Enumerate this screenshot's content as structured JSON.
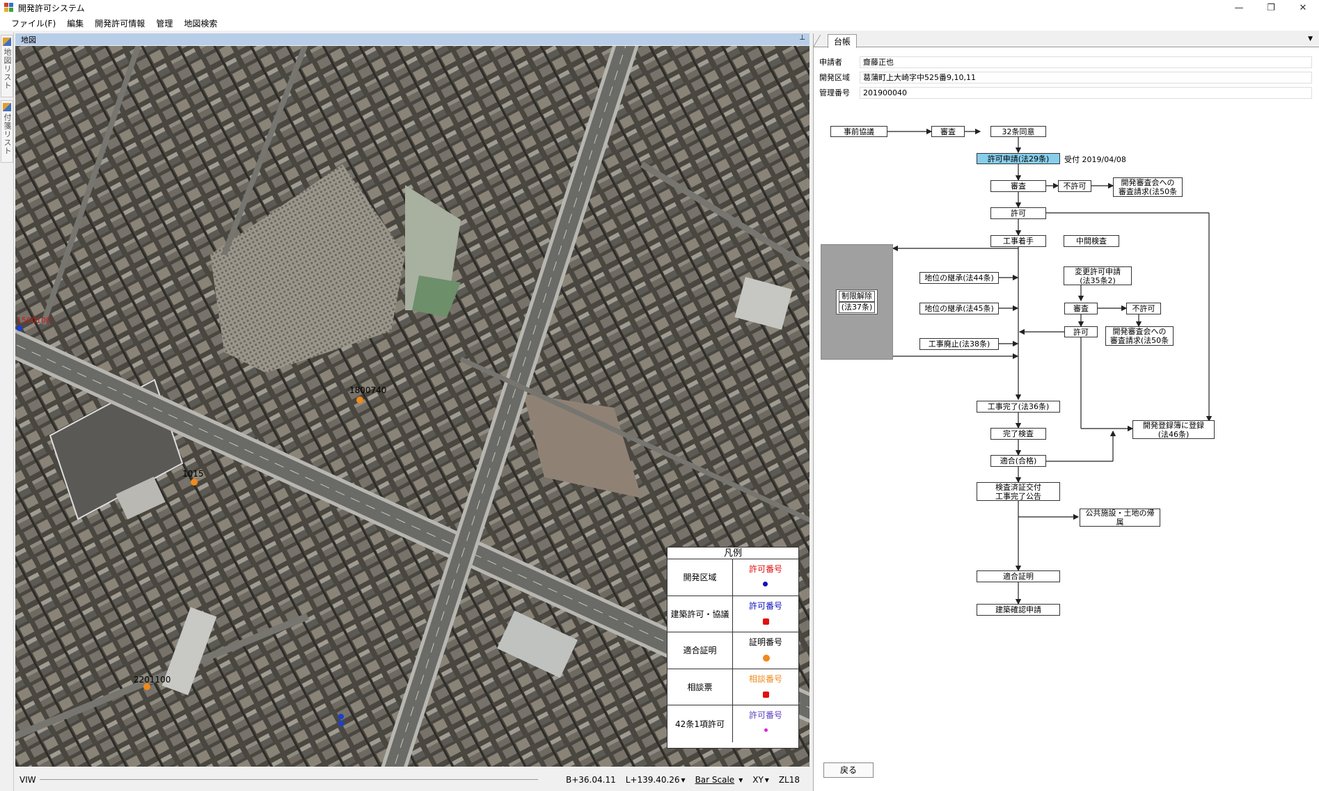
{
  "window": {
    "title": "開発許可システム",
    "controls": {
      "minimize": "—",
      "maximize": "❐",
      "close": "✕"
    }
  },
  "menu": {
    "items": [
      "ファイル(F)",
      "編集",
      "開発許可情報",
      "管理",
      "地図検索"
    ]
  },
  "side_tabs": [
    "地図リスト",
    "付箋リスト"
  ],
  "map": {
    "header": "地図",
    "pin": "⊥",
    "markers": [
      {
        "label": "1500100",
        "color": "#1a3fd6",
        "label_color": "#d01818"
      },
      {
        "label": "1800740",
        "color": "#f08a1c",
        "label_color": "#000000"
      },
      {
        "label": "1015",
        "color": "#f08a1c",
        "label_color": "#000000"
      },
      {
        "label": "2201100",
        "color": "#f08a1c",
        "label_color": "#000000"
      },
      {
        "label": "",
        "color": "#1a3fd6",
        "label_color": "#d01818"
      }
    ],
    "legend": {
      "title": "凡例",
      "rows": [
        {
          "name": "開発区域",
          "label": "許可番号",
          "label_color": "#e01010",
          "symbol_color": "#1010c0"
        },
        {
          "name": "建築許可・協議",
          "label": "許可番号",
          "label_color": "#1010c0",
          "symbol_color": "#e01010"
        },
        {
          "name": "適合証明",
          "label": "証明番号",
          "label_color": "#000000",
          "symbol_color": "#f08a1c"
        },
        {
          "name": "相談票",
          "label": "相談番号",
          "label_color": "#f08a1c",
          "symbol_color": "#e01010"
        },
        {
          "name": "42条1項許可",
          "label": "許可番号",
          "label_color": "#6040c0",
          "symbol_color": "#e020e0"
        }
      ]
    }
  },
  "status": {
    "viw": "VIW",
    "lat": "B+36.04.11",
    "lon": "L+139.40.26",
    "scale": "Bar Scale",
    "coord": "XY",
    "zoom": "ZL18"
  },
  "ledger": {
    "tab": "台帳",
    "applicant_label": "申請者",
    "applicant": "齋藤正也",
    "area_label": "開発区域",
    "area": "葛蒲町上大崎字中525番9,10,11",
    "mgmt_label": "管理番号",
    "mgmt_no": "201900040",
    "flow": {
      "pre": "事前協議",
      "review1": "審査",
      "art32": "32条同意",
      "apply": "許可申請(法29条)",
      "received": "受付 2019/04/08",
      "review2": "審査",
      "deny1": "不許可",
      "appeal1_l1": "開発審査会への",
      "appeal1_l2": "審査請求(法50条",
      "permit": "許可",
      "start": "工事着手",
      "mid": "中間検査",
      "lift_l1": "制限解除",
      "lift_l2": "(法37条)",
      "succ44": "地位の継承(法44条)",
      "succ45": "地位の継承(法45条)",
      "abolish": "工事廃止(法38条)",
      "change_l1": "変更許可申請",
      "change_l2": "(法35条2)",
      "review3": "審査",
      "deny2": "不許可",
      "permit2": "許可",
      "appeal2_l1": "開発審査会への",
      "appeal2_l2": "審査請求(法50条",
      "register_l1": "開発登録簿に登録",
      "register_l2": "(法46条)",
      "complete": "工事完了(法36条)",
      "inspection": "完了検査",
      "pass": "適合(合格)",
      "cert_l1": "検査済証交付",
      "cert_l2": "工事完了公告",
      "public_l1": "公共施設・土地の帰",
      "public_l2": "属",
      "conformity": "適合証明",
      "building": "建築確認申請"
    },
    "back": "戻る"
  }
}
